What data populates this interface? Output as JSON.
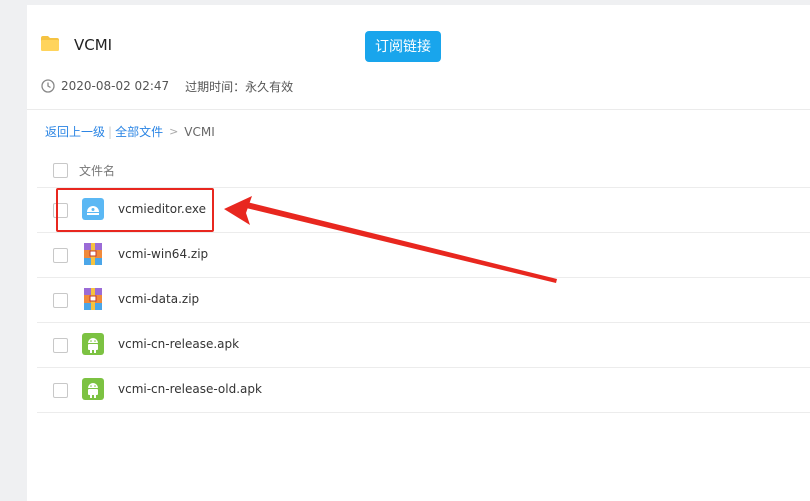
{
  "folder": {
    "name": "VCMI",
    "subscribe_label": "订阅链接",
    "date": "2020-08-02 02:47",
    "expire": "过期时间：永久有效"
  },
  "breadcrumb": {
    "back": "返回上一级",
    "all": "全部文件",
    "current": "VCMI",
    "sep": "|",
    "gt": ">"
  },
  "table": {
    "column_name": "文件名",
    "rows": [
      {
        "name": "vcmieditor.exe",
        "icon": "exe-icon"
      },
      {
        "name": "vcmi-win64.zip",
        "icon": "zip-icon"
      },
      {
        "name": "vcmi-data.zip",
        "icon": "zip-icon"
      },
      {
        "name": "vcmi-cn-release.apk",
        "icon": "apk-icon"
      },
      {
        "name": "vcmi-cn-release-old.apk",
        "icon": "apk-icon"
      }
    ]
  },
  "colors": {
    "accent": "#19a5ec",
    "link": "#2b85e4",
    "annotation": "#e8271f",
    "apk": "#7cc242",
    "exe": "#5bb8f4"
  }
}
